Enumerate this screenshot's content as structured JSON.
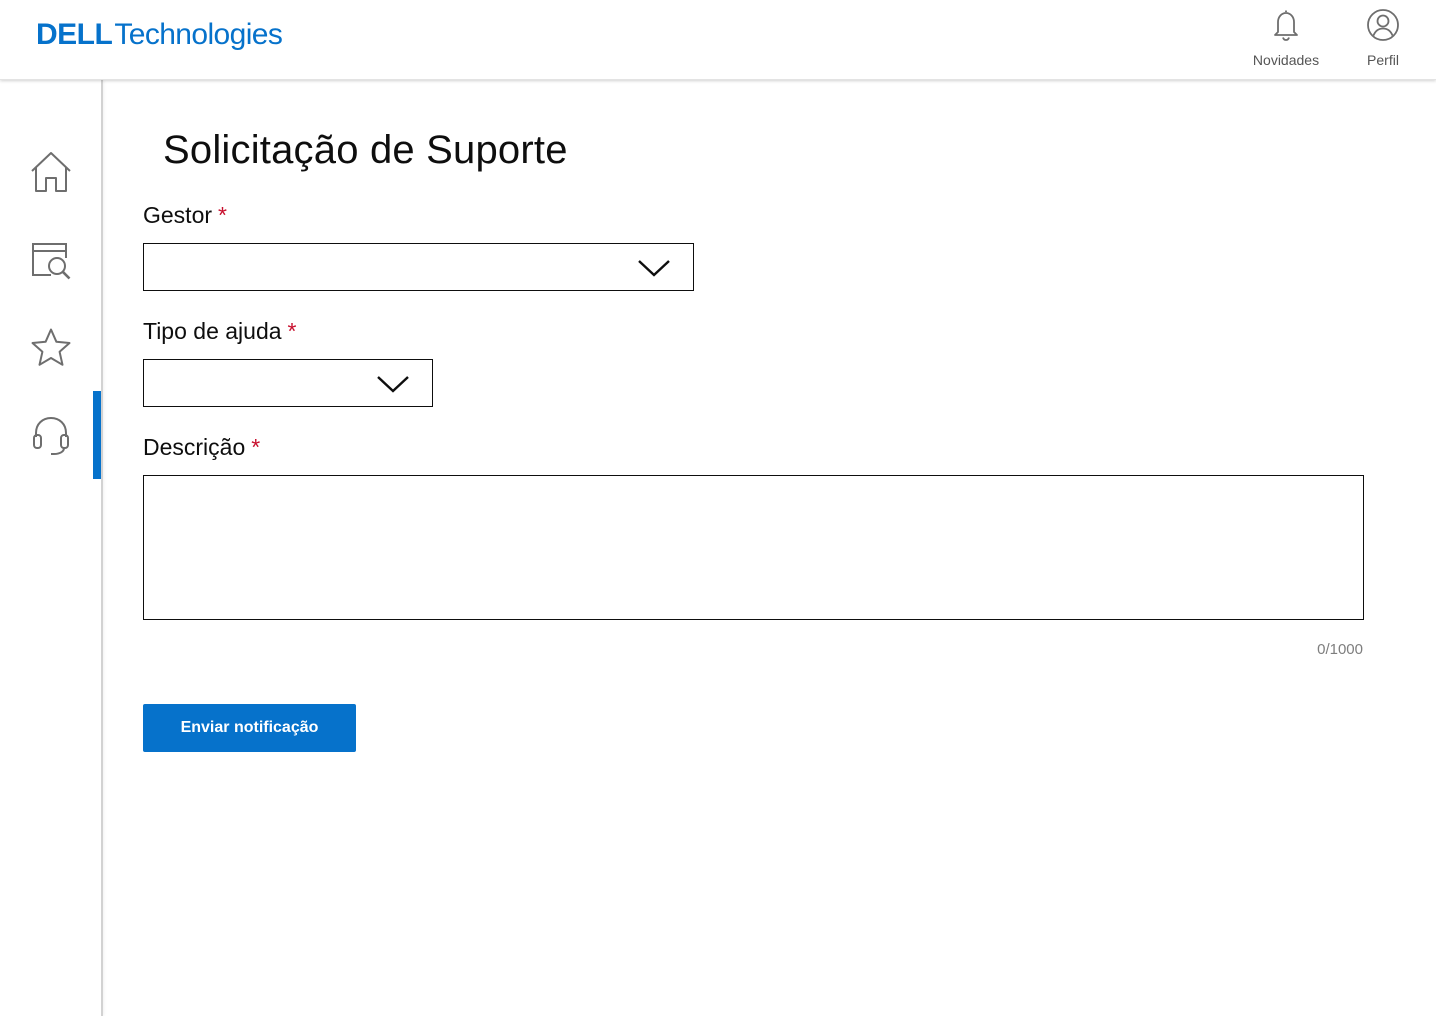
{
  "header": {
    "logo_brand": "DELL",
    "logo_suffix": "Technologies",
    "actions": [
      {
        "label": "Novidades",
        "icon": "bell-icon"
      },
      {
        "label": "Perfil",
        "icon": "user-circle-icon"
      }
    ]
  },
  "sidebar": {
    "items": [
      {
        "id": "home",
        "icon": "home-icon",
        "active": false
      },
      {
        "id": "search-page",
        "icon": "page-search-icon",
        "active": false
      },
      {
        "id": "favorites",
        "icon": "star-icon",
        "active": false
      },
      {
        "id": "support",
        "icon": "headset-icon",
        "active": true
      }
    ]
  },
  "form": {
    "title": "Solicitação de Suporte",
    "required_marker": "*",
    "gestor": {
      "label": "Gestor",
      "value": ""
    },
    "tipo_ajuda": {
      "label": "Tipo de ajuda",
      "value": ""
    },
    "descricao": {
      "label": "Descrição",
      "value": "",
      "counter": "0/1000"
    },
    "submit_label": "Enviar notificação"
  },
  "colors": {
    "accent": "#0672cb",
    "required": "#c8102e",
    "text": "#0e0e0e",
    "icon_gray": "#6e6e6e"
  }
}
